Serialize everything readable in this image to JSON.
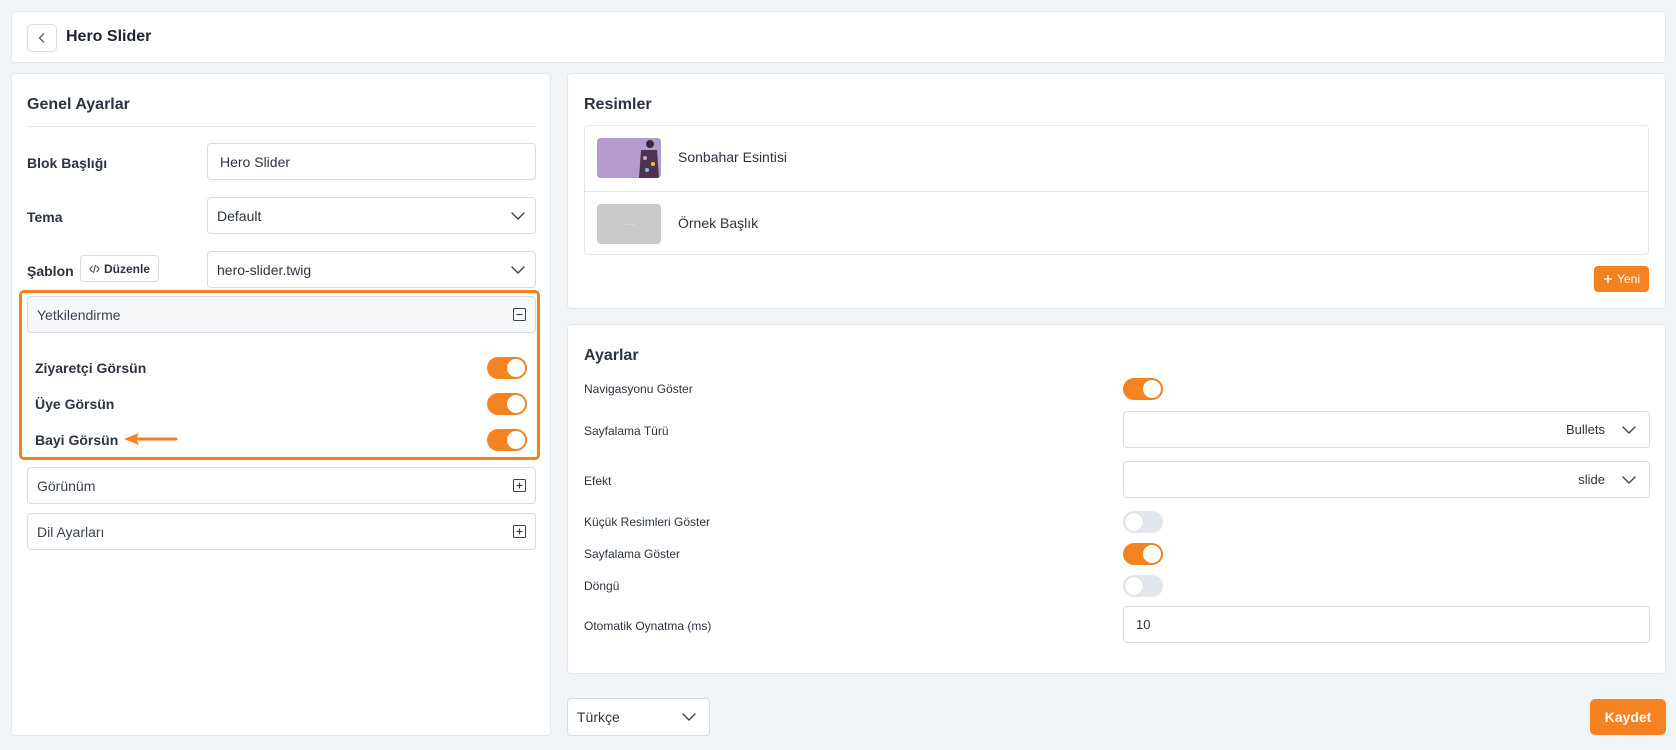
{
  "header": {
    "title": "Hero Slider"
  },
  "left": {
    "title": "Genel Ayarlar",
    "fields": {
      "block_title_label": "Blok Başlığı",
      "block_title_value": "Hero Slider",
      "theme_label": "Tema",
      "theme_value": "Default",
      "template_label": "Şablon",
      "edit_label": "Düzenle",
      "template_value": "hero-slider.twig"
    },
    "accordions": {
      "auth": {
        "title": "Yetkilendirme",
        "toggles": [
          {
            "label": "Ziyaretçi Görsün",
            "on": true
          },
          {
            "label": "Üye Görsün",
            "on": true
          },
          {
            "label": "Bayi Görsün",
            "on": true
          }
        ]
      },
      "view": {
        "title": "Görünüm"
      },
      "lang": {
        "title": "Dil Ayarları"
      }
    }
  },
  "images": {
    "title": "Resimler",
    "items": [
      {
        "name": "Sonbahar Esintisi"
      },
      {
        "name": "Örnek Başlık",
        "placeholder": "···"
      }
    ],
    "new_label": "Yeni"
  },
  "settings": {
    "title": "Ayarlar",
    "rows": {
      "nav_label": "Navigasyonu Göster",
      "nav_on": true,
      "pagination_type_label": "Sayfalama Türü",
      "pagination_type_value": "Bullets",
      "effect_label": "Efekt",
      "effect_value": "slide",
      "thumbs_label": "Küçük Resimleri Göster",
      "thumbs_on": false,
      "pagination_label": "Sayfalama Göster",
      "pagination_on": true,
      "loop_label": "Döngü",
      "loop_on": false,
      "autoplay_label": "Otomatik Oynatma (ms)",
      "autoplay_value": "10"
    }
  },
  "footer": {
    "language_value": "Türkçe",
    "save_label": "Kaydet"
  },
  "colors": {
    "accent": "#f58220",
    "background": "#f1f4f7",
    "border": "#d7dce2"
  }
}
